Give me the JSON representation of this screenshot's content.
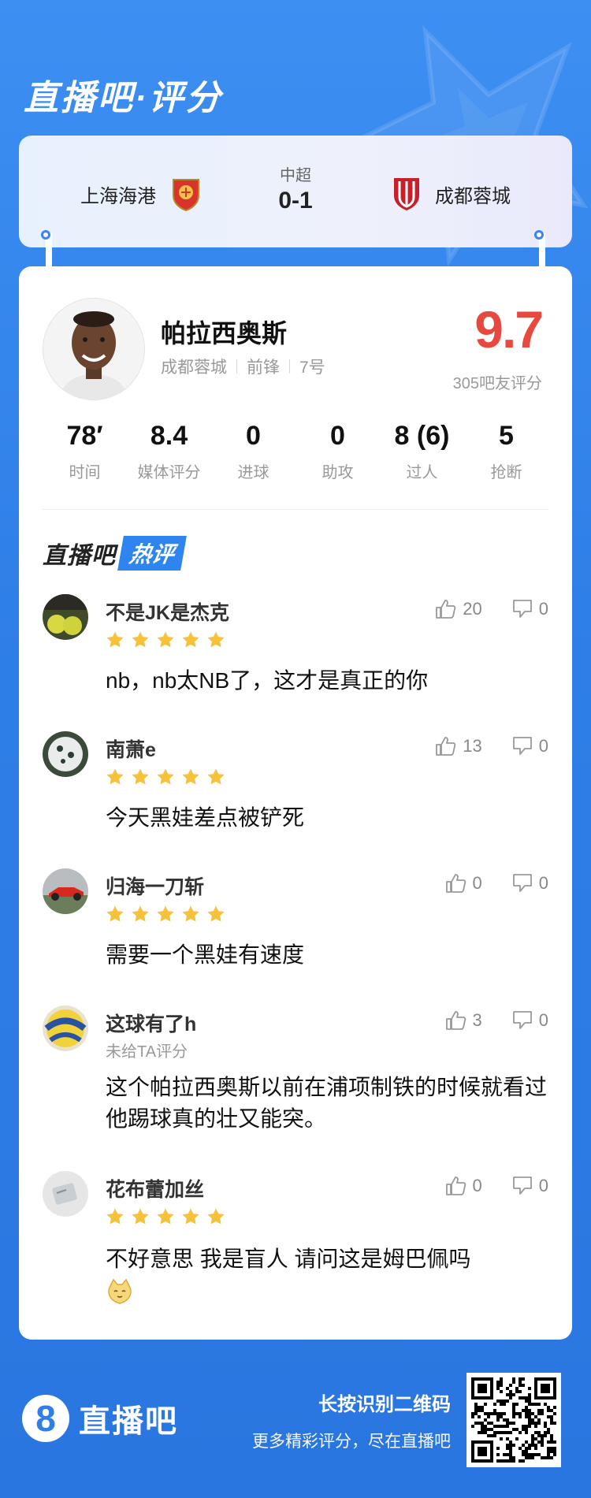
{
  "brand": {
    "title": "直播吧·评分"
  },
  "match": {
    "home_team": "上海海港",
    "away_team": "成都蓉城",
    "league": "中超",
    "score": "0-1"
  },
  "player": {
    "name": "帕拉西奥斯",
    "team": "成都蓉城",
    "position": "前锋",
    "number": "7号",
    "rating": "9.7",
    "rating_sub": "305吧友评分"
  },
  "stats": [
    {
      "value": "78′",
      "label": "时间"
    },
    {
      "value": "8.4",
      "label": "媒体评分"
    },
    {
      "value": "0",
      "label": "进球"
    },
    {
      "value": "0",
      "label": "助攻"
    },
    {
      "value": "8 (6)",
      "label": "过人"
    },
    {
      "value": "5",
      "label": "抢断"
    }
  ],
  "hot": {
    "part1": "直播吧",
    "part2": "热评"
  },
  "comments": [
    {
      "user": "不是JK是杰克",
      "likes": "20",
      "dislikes": "0",
      "stars": 5,
      "text": "nb，nb太NB了，这才是真正的你"
    },
    {
      "user": "南萧e",
      "likes": "13",
      "dislikes": "0",
      "stars": 5,
      "text": "今天黑娃差点被铲死"
    },
    {
      "user": "归海一刀斩",
      "likes": "0",
      "dislikes": "0",
      "stars": 5,
      "text": "需要一个黑娃有速度"
    },
    {
      "user": "这球有了h",
      "likes": "3",
      "dislikes": "0",
      "sub": "未给TA评分",
      "text": "这个帕拉西奥斯以前在浦项制铁的时候就看过他踢球真的壮又能突。"
    },
    {
      "user": "花布蕾加丝",
      "likes": "0",
      "dislikes": "0",
      "stars": 5,
      "text": "不好意思 我是盲人 请问这是姆巴佩吗"
    }
  ],
  "footer": {
    "logo_digit": "8",
    "logo_text": "直播吧",
    "cta1": "长按识别二维码",
    "cta2": "更多精彩评分，尽在直播吧"
  },
  "colors": {
    "accent": "#2f85f0",
    "rating": "#e8493f",
    "star": "#f7c23b"
  }
}
